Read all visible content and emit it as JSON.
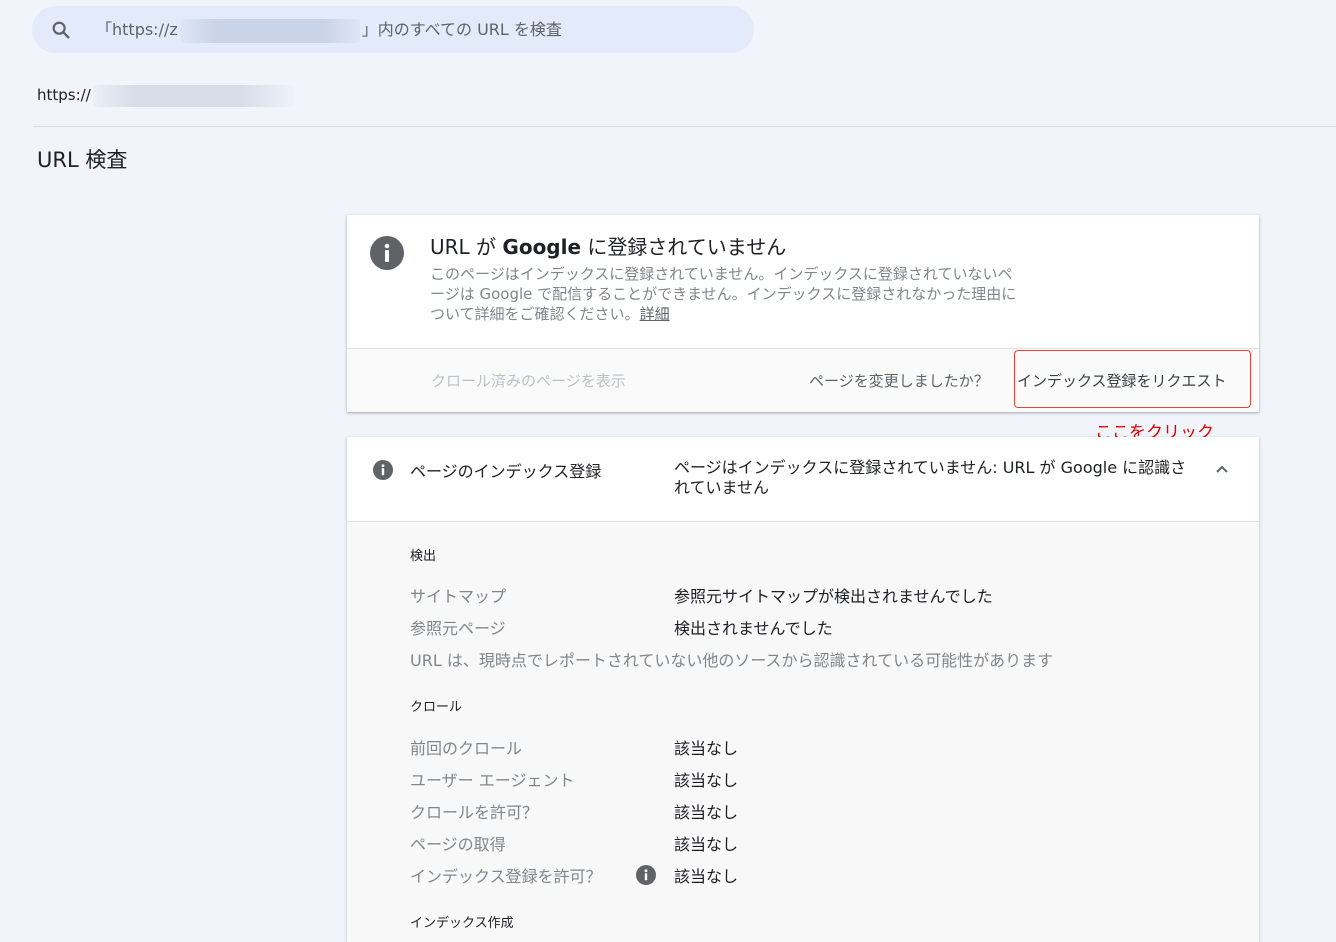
{
  "search": {
    "prefix": "「https://z",
    "suffix": "」内のすべての URL を検査",
    "icon": "search-icon"
  },
  "inspected_url": {
    "prefix": "https://"
  },
  "page_title": "URL 検査",
  "summary": {
    "icon": "info-icon",
    "title_prefix": "URL が ",
    "title_brand": "Google",
    "title_suffix": " に登録されていません",
    "description": "このページはインデックスに登録されていません。インデックスに登録されていないページは Google で配信することができません。インデックスに登録されなかった理由について詳細をご確認ください。",
    "learn_more": "詳細",
    "view_crawled": "クロール済みのページを表示",
    "changed_question": "ページを変更しましたか？",
    "request_indexing": "インデックス登録をリクエスト"
  },
  "annotation": "ここをクリック",
  "colors": {
    "annotation": "#e00000",
    "highlight_border": "#ea4335",
    "background": "#f1f4fb"
  },
  "indexing": {
    "label": "ページのインデックス登録",
    "value": "ページはインデックスに登録されていません: URL が Google に認識されていません",
    "sections": {
      "discovery": {
        "title": "検出",
        "rows": [
          {
            "label": "サイトマップ",
            "value": "参照元サイトマップが検出されませんでした"
          },
          {
            "label": "参照元ページ",
            "value": "検出されませんでした"
          }
        ],
        "note": "URL は、現時点でレポートされていない他のソースから認識されている可能性があります"
      },
      "crawl": {
        "title": "クロール",
        "rows": [
          {
            "label": "前回のクロール",
            "value": "該当なし"
          },
          {
            "label": "ユーザー エージェント",
            "value": "該当なし"
          },
          {
            "label": "クロールを許可？",
            "value": "該当なし"
          },
          {
            "label": "ページの取得",
            "value": "該当なし"
          },
          {
            "label": "インデックス登録を許可？",
            "value": "該当なし"
          }
        ]
      },
      "indexing_creation": {
        "title": "インデックス作成"
      }
    }
  }
}
